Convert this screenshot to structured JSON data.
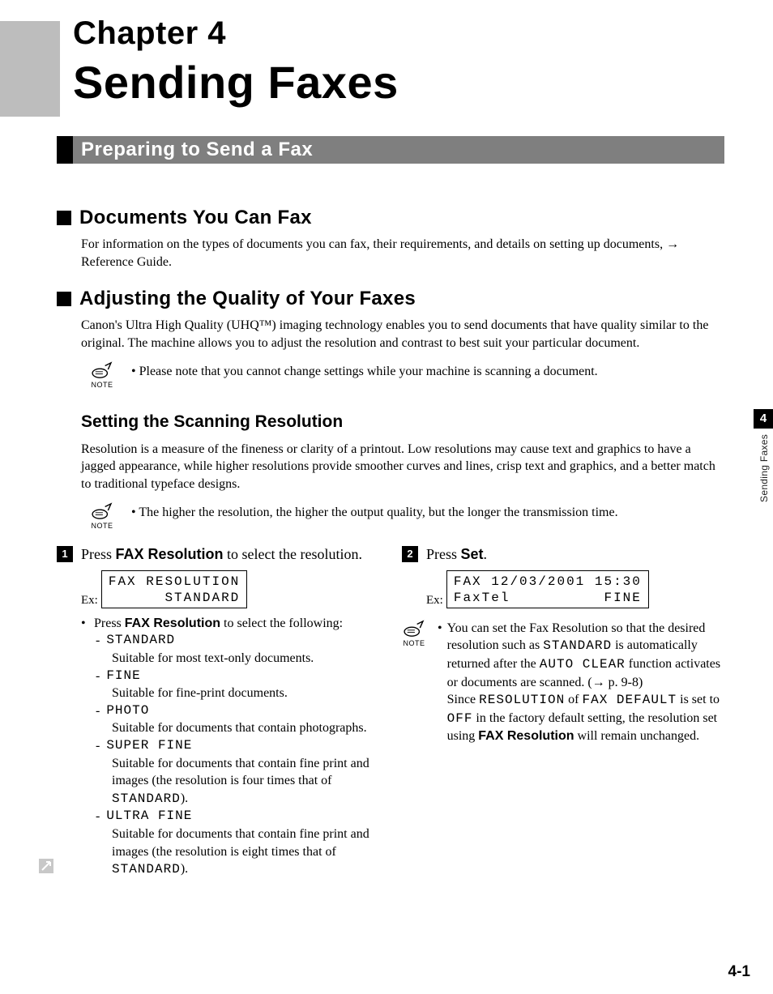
{
  "chapter": {
    "num": "Chapter 4",
    "title": "Sending Faxes"
  },
  "h1": "Preparing to Send a Fax",
  "sec1": {
    "title": "Documents You Can Fax",
    "body": "For information on the types of documents you can fax, their requirements, and details on setting up documents, → Reference Guide."
  },
  "sec2": {
    "title": "Adjusting the Quality of Your Faxes",
    "body": "Canon's Ultra High Quality (UHQ™) imaging technology enables you to send documents that have quality similar to the original. The machine allows you to adjust the resolution and contrast to best suit your particular document.",
    "note": "Please note that you cannot change settings while your machine is scanning a document."
  },
  "noteLabel": "NOTE",
  "sec3": {
    "title": "Setting the Scanning Resolution",
    "body": "Resolution is a measure of the fineness or clarity of a printout. Low resolutions may cause text and graphics to have a jagged appearance, while higher resolutions provide smoother curves and lines, crisp text and graphics, and a better match to traditional typeface designs.",
    "note": "The higher the resolution, the higher the output quality, but the longer the transmission time."
  },
  "step1": {
    "num": "1",
    "text_pre": "Press ",
    "key": "FAX Resolution",
    "text_post": " to select the resolution.",
    "exLabel": "Ex:",
    "lcd_l1": "FAX RESOLUTION",
    "lcd_l2": "STANDARD",
    "sub_pre": "Press ",
    "sub_key": "FAX Resolution",
    "sub_post": " to select the following:",
    "opts": [
      {
        "name": "STANDARD",
        "desc": "Suitable for most text-only documents."
      },
      {
        "name": "FINE",
        "desc": "Suitable for fine-print documents."
      },
      {
        "name": "PHOTO",
        "desc": "Suitable for documents that contain photographs."
      },
      {
        "name": "SUPER FINE",
        "desc1": "Suitable for documents that contain fine print and images (the resolution is four times that of ",
        "code": "STANDARD",
        "desc2": ")."
      },
      {
        "name": "ULTRA FINE",
        "desc1": "Suitable for documents that contain fine print and images (the resolution is eight times that of ",
        "code": "STANDARD",
        "desc2": ")."
      }
    ]
  },
  "step2": {
    "num": "2",
    "text_pre": "Press ",
    "key": "Set",
    "text_post": ".",
    "exLabel": "Ex:",
    "lcd_l1": "FAX 12/03/2001 15:30",
    "lcd_l2a": "FaxTel",
    "lcd_l2b": "FINE",
    "note_a": "You can set the Fax Resolution so that the desired resolution such as ",
    "note_code1": "STANDARD",
    "note_b": " is automatically returned after the ",
    "note_code2": "AUTO CLEAR",
    "note_c": " function activates or documents are scanned. (→ p. 9-8)",
    "note_d": "Since ",
    "note_code3": "RESOLUTION",
    "note_e": " of ",
    "note_code4": "FAX DEFAULT",
    "note_f": " is set to ",
    "note_code5": "OFF",
    "note_g": " in the factory default setting, the resolution set using ",
    "note_key": "FAX Resolution",
    "note_h": " will remain unchanged."
  },
  "sideTab": {
    "num": "4",
    "label": "Sending Faxes"
  },
  "pageNum": "4-1"
}
